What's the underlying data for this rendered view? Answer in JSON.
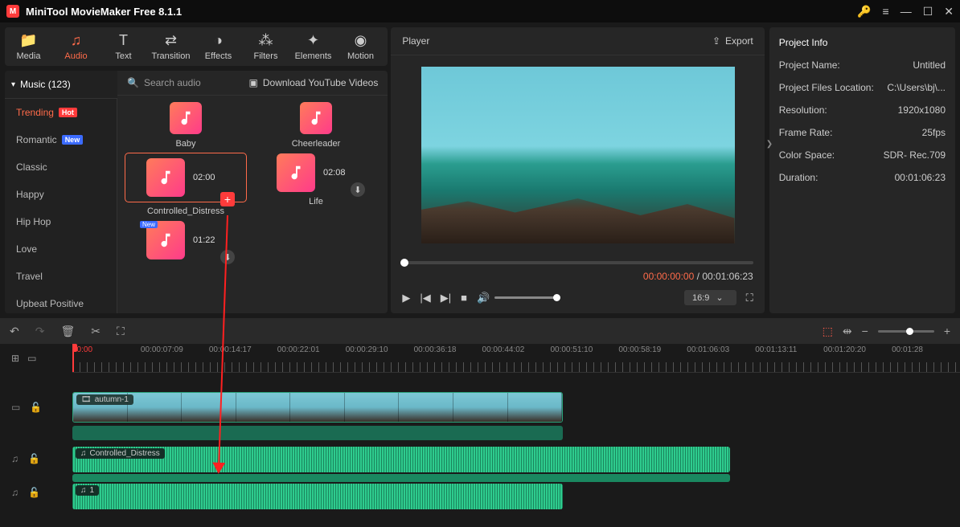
{
  "app": {
    "title": "MiniTool MovieMaker Free 8.1.1"
  },
  "tools": [
    {
      "icon": "folder",
      "label": "Media"
    },
    {
      "icon": "music",
      "label": "Audio"
    },
    {
      "icon": "text",
      "label": "Text"
    },
    {
      "icon": "transition",
      "label": "Transition"
    },
    {
      "icon": "effects",
      "label": "Effects"
    },
    {
      "icon": "filters",
      "label": "Filters"
    },
    {
      "icon": "elements",
      "label": "Elements"
    },
    {
      "icon": "motion",
      "label": "Motion"
    }
  ],
  "active_tool": 1,
  "sidebar": {
    "header": "Music (123)",
    "items": [
      {
        "label": "Trending",
        "badge": "Hot",
        "badgeClass": "hot"
      },
      {
        "label": "Romantic",
        "badge": "New",
        "badgeClass": "new"
      },
      {
        "label": "Classic"
      },
      {
        "label": "Happy"
      },
      {
        "label": "Hip Hop"
      },
      {
        "label": "Love"
      },
      {
        "label": "Travel"
      },
      {
        "label": "Upbeat Positive"
      }
    ],
    "active": 0
  },
  "library": {
    "search_placeholder": "Search audio",
    "download_label": "Download YouTube Videos",
    "cards": [
      {
        "label": "Baby",
        "duration": ""
      },
      {
        "label": "Cheerleader",
        "duration": ""
      },
      {
        "label": "Controlled_Distress",
        "duration": "02:00",
        "selected": true,
        "overlay": "add"
      },
      {
        "label": "Life",
        "duration": "02:08",
        "overlay": "dl"
      },
      {
        "label": "",
        "duration": "01:22",
        "newBadge": true,
        "overlay": "dl"
      }
    ]
  },
  "player": {
    "title": "Player",
    "export_label": "Export",
    "current_time": "00:00:00:00",
    "total_time": "00:01:06:23",
    "aspect": "16:9"
  },
  "project": {
    "title": "Project Info",
    "rows": [
      {
        "k": "Project Name:",
        "v": "Untitled"
      },
      {
        "k": "Project Files Location:",
        "v": "C:\\Users\\bj\\..."
      },
      {
        "k": "Resolution:",
        "v": "1920x1080"
      },
      {
        "k": "Frame Rate:",
        "v": "25fps"
      },
      {
        "k": "Color Space:",
        "v": "SDR- Rec.709"
      },
      {
        "k": "Duration:",
        "v": "00:01:06:23"
      }
    ]
  },
  "timeline": {
    "marks": [
      "00:00",
      "00:00:07:09",
      "00:00:14:17",
      "00:00:22:01",
      "00:00:29:10",
      "00:00:36:18",
      "00:00:44:02",
      "00:00:51:10",
      "00:00:58:19",
      "00:01:06:03",
      "00:01:13:11",
      "00:01:20:20",
      "00:01:28"
    ],
    "video_clip": "autumn-1",
    "audio_clip1": "Controlled_Distress",
    "audio_clip2": "1"
  }
}
